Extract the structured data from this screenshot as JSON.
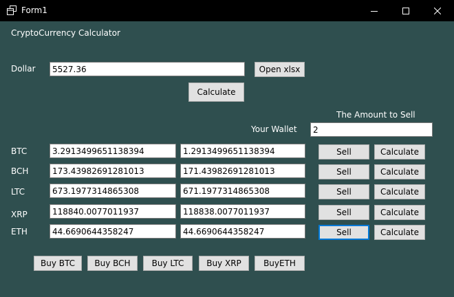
{
  "window": {
    "title": "Form1"
  },
  "app": {
    "heading": "CryptoCurrency Calculator"
  },
  "dollar": {
    "label": "Dollar",
    "value": "5527.36"
  },
  "buttons": {
    "open_xlsx": "Open xlsx",
    "calculate": "Calculate"
  },
  "sell_amount": {
    "label": "The Amount to Sell",
    "value": "2"
  },
  "wallet": {
    "label": "Your Wallet"
  },
  "rows": [
    {
      "label": "BTC",
      "value": "3.2913499651138394",
      "wallet": "1.2913499651138394",
      "sell": "Sell",
      "calc": "Calculate"
    },
    {
      "label": "BCH",
      "value": "173.43982691281013",
      "wallet": "171.43982691281013",
      "sell": "Sell",
      "calc": "Calculate"
    },
    {
      "label": "LTC",
      "value": "673.1977314865308",
      "wallet": "671.1977314865308",
      "sell": "Sell",
      "calc": "Calculate"
    },
    {
      "label": "XRP",
      "value": "118840.0077011937",
      "wallet": "118838.0077011937",
      "sell": "Sell",
      "calc": "Calculate"
    },
    {
      "label": "ETH",
      "value": "44.6690644358247",
      "wallet": "44.6690644358247",
      "sell": "Sell",
      "calc": "Calculate"
    }
  ],
  "buy": [
    "Buy BTC",
    "Buy BCH",
    "Buy LTC",
    "Buy XRP",
    "BuyETH"
  ]
}
